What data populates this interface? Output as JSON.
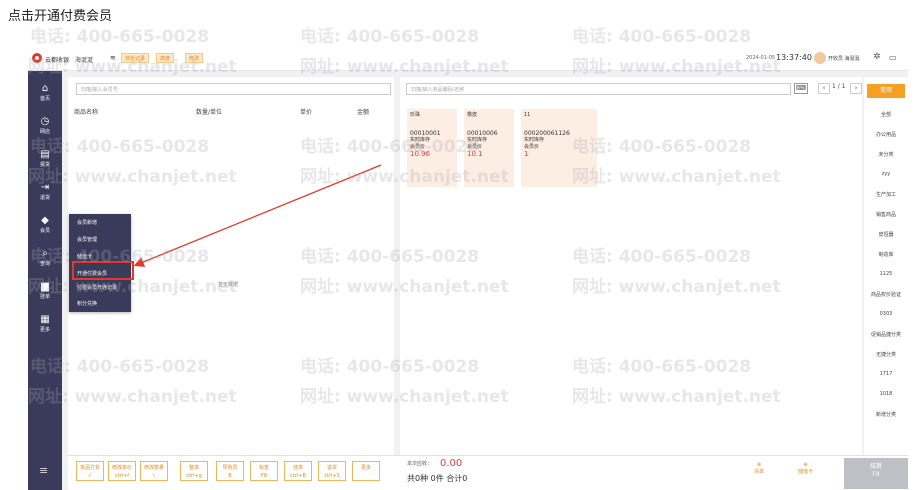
{
  "caption": "点击开通付费会员",
  "topbar": {
    "brand": "云都收银",
    "store": "海涎涎",
    "tags": [
      "体检记录",
      "高度",
      "修改"
    ],
    "date": "2024-01-05",
    "time": "13:37:40",
    "user": "开收员 海涎涎"
  },
  "sidebar": [
    {
      "icon": "home-icon",
      "glyph": "⌂",
      "label": "首页"
    },
    {
      "icon": "clock-icon",
      "glyph": "◷",
      "label": "网店"
    },
    {
      "icon": "report-icon",
      "glyph": "▤",
      "label": "报货"
    },
    {
      "icon": "exit-icon",
      "glyph": "⇥",
      "label": "退货"
    },
    {
      "icon": "diamond-icon",
      "glyph": "◆",
      "label": "会员"
    },
    {
      "icon": "search-icon",
      "glyph": "⌕",
      "label": "查询"
    },
    {
      "icon": "bag-icon",
      "glyph": "▆",
      "label": "挂单"
    },
    {
      "icon": "grid-icon",
      "glyph": "▦",
      "label": "更多"
    }
  ],
  "left": {
    "search_placeholder": "扫描/输入会员号",
    "headers": [
      "商品名称",
      "数量/单位",
      "单价",
      "金额"
    ],
    "empty": "暂无数据"
  },
  "right": {
    "search_placeholder": "扫描/输入商品编码/名称",
    "page": "1 / 1",
    "prev": "‹",
    "next": "›",
    "products": [
      {
        "name": "珍珠",
        "code": "00010001",
        "stock": "实时库存",
        "member": "会员价",
        "price": "10.96"
      },
      {
        "name": "橡皮",
        "code": "00010006",
        "stock": "实时库存",
        "member": "会员价",
        "price": "10.1"
      },
      {
        "name": "11",
        "code": "000200061126",
        "stock": "实时库存",
        "member": "会员价",
        "price": "1"
      }
    ]
  },
  "categories": {
    "active": "常用",
    "items": [
      "全部",
      "办公用品",
      "未分类",
      "zyy",
      "生产加工",
      "销售商品",
      "皮恒器",
      "制造库",
      "1125",
      "商品权价验证",
      "0303",
      "促销品捷分类",
      "无捷分类",
      "1717",
      "1018",
      "新增分类"
    ]
  },
  "menu": {
    "items": [
      "会员新增",
      "会员管理",
      "储值卡",
      "开通付费会员",
      "付费会员开通记录",
      "积分兑换"
    ]
  },
  "bottom": {
    "buttons": [
      {
        "label": "单品打折",
        "key": "✓"
      },
      {
        "label": "修改单价",
        "key": "ctrl+f"
      },
      {
        "label": "修改数量",
        "key": "\\"
      },
      {
        "label": "整单",
        "key": "ctrl+g"
      },
      {
        "label": "导购员",
        "key": "B"
      },
      {
        "label": "标签",
        "key": "F8"
      },
      {
        "label": "挂单",
        "key": "ctrl+B"
      },
      {
        "label": "退货",
        "key": "ctrl+S"
      },
      {
        "label": "更多",
        "key": ""
      }
    ],
    "receivable_label": "本次应收：",
    "receivable": "0.00",
    "summary": "共0种 0件 合计0",
    "icon1": "清单",
    "icon2": "储值卡",
    "pay": "结算",
    "pay_key": "F9"
  },
  "watermark": {
    "phone": "电话: 400-665-0028",
    "site": "网址: www.chanjet.net"
  }
}
